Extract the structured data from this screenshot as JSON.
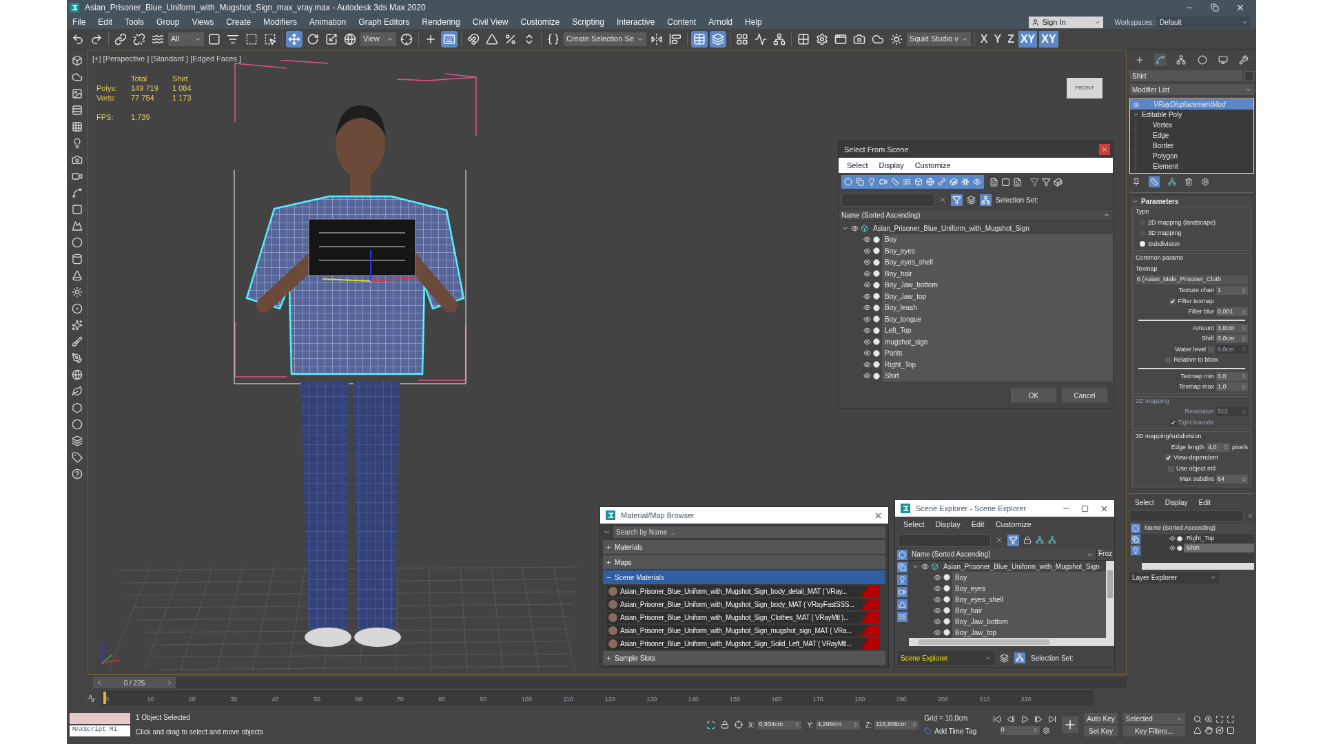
{
  "window": {
    "title": "Asian_Prisoner_Blue_Uniform_with_Mugshot_Sign_max_vray.max - Autodesk 3ds Max 2020"
  },
  "menu": [
    "File",
    "Edit",
    "Tools",
    "Group",
    "Views",
    "Create",
    "Modifiers",
    "Animation",
    "Graph Editors",
    "Rendering",
    "Civil View",
    "Customize",
    "Scripting",
    "Interactive",
    "Content",
    "Arnold",
    "Help"
  ],
  "account": {
    "sign_in": "Sign In",
    "workspaces_label": "Workspaces:",
    "workspace": "Default"
  },
  "toolbar": [
    {
      "kind": "undo",
      "selected": false
    },
    {
      "kind": "redo",
      "selected": false
    },
    {
      "kind": "sep"
    },
    {
      "kind": "link",
      "selected": false
    },
    {
      "kind": "unlink",
      "selected": false
    },
    {
      "kind": "bind",
      "selected": false
    },
    {
      "kind": "dropdown",
      "value": "All"
    },
    {
      "kind": "select",
      "selected": false
    },
    {
      "kind": "select_by_name",
      "selected": false
    },
    {
      "kind": "region",
      "selected": false
    },
    {
      "kind": "crossing",
      "selected": false
    },
    {
      "kind": "sep"
    },
    {
      "kind": "move",
      "selected": true
    },
    {
      "kind": "rotate",
      "selected": false
    },
    {
      "kind": "scale",
      "selected": false
    },
    {
      "kind": "place",
      "selected": false
    },
    {
      "kind": "dropdown",
      "value": "View"
    },
    {
      "kind": "pivot",
      "selected": false
    },
    {
      "kind": "sep"
    },
    {
      "kind": "manipulate",
      "selected": false
    },
    {
      "kind": "shortcut",
      "selected": true
    },
    {
      "kind": "sep"
    },
    {
      "kind": "snap",
      "selected": false
    },
    {
      "kind": "angle",
      "selected": false
    },
    {
      "kind": "percent",
      "selected": false
    },
    {
      "kind": "spinner",
      "selected": false
    },
    {
      "kind": "sep"
    },
    {
      "kind": "named_sel",
      "selected": false
    },
    {
      "kind": "dropdown",
      "value": "Create Selection Se"
    },
    {
      "kind": "mirror",
      "selected": false
    },
    {
      "kind": "align",
      "selected": false
    },
    {
      "kind": "sep"
    },
    {
      "kind": "scene_explorer",
      "selected": true
    },
    {
      "kind": "layer_explorer",
      "selected": true
    },
    {
      "kind": "sep"
    },
    {
      "kind": "ribbon",
      "selected": false
    },
    {
      "kind": "curve_editor",
      "selected": false
    },
    {
      "kind": "schematic",
      "selected": false
    },
    {
      "kind": "sep"
    },
    {
      "kind": "material_editor",
      "selected": false
    },
    {
      "kind": "render_setup",
      "selected": false
    },
    {
      "kind": "render_frame",
      "selected": false
    },
    {
      "kind": "render",
      "selected": false
    },
    {
      "kind": "render_cloud",
      "selected": false
    },
    {
      "kind": "active_shade",
      "selected": false
    },
    {
      "kind": "dropdown",
      "value": "Squid Studio v"
    },
    {
      "kind": "sep"
    },
    {
      "kind": "axis",
      "label": "X",
      "selected": false
    },
    {
      "kind": "axis",
      "label": "Y",
      "selected": false
    },
    {
      "kind": "axis",
      "label": "Z",
      "selected": false
    },
    {
      "kind": "axis",
      "label": "XY",
      "selected": true
    },
    {
      "kind": "axis",
      "label": "XY",
      "selected": true
    }
  ],
  "viewport": {
    "label": "[+] [Perspective ] [Standard ] [Edged Faces ]",
    "stats": {
      "headers": [
        "Total",
        "Shirt"
      ],
      "rows": [
        {
          "label": "Polys:",
          "values": [
            "149 719",
            "1 084"
          ]
        },
        {
          "label": "Verts:",
          "values": [
            "77 754",
            "1 173"
          ]
        }
      ],
      "fps_label": "FPS:",
      "fps": "1,739"
    },
    "viewcube": "FRONT"
  },
  "select_from_scene": {
    "title": "Select From Scene",
    "menu": [
      "Select",
      "Display",
      "Customize"
    ],
    "filters": [
      {
        "kind": "geometry",
        "on": true
      },
      {
        "kind": "shapes",
        "on": true
      },
      {
        "kind": "lights",
        "on": true
      },
      {
        "kind": "cameras",
        "on": true
      },
      {
        "kind": "helpers",
        "on": true
      },
      {
        "kind": "spacewarps",
        "on": true
      },
      {
        "kind": "groups",
        "on": true
      },
      {
        "kind": "xrefs",
        "on": true
      },
      {
        "kind": "bones",
        "on": true
      },
      {
        "kind": "containers",
        "on": true
      },
      {
        "kind": "particles",
        "on": true
      },
      {
        "kind": "frozen",
        "on": true
      }
    ],
    "selection_set_label": "Selection Set:",
    "column": "Name (Sorted Ascending)",
    "tree": {
      "label": "Asian_Prisoner_Blue_Uniform_with_Mugshot_Sign",
      "expanded": true,
      "children": [
        "Boy",
        "Boy_eyes",
        "Boy_eyes_shell",
        "Boy_hair",
        "Boy_Jaw_bottom",
        "Boy_Jaw_top",
        "Boy_leash",
        "Boy_tongue",
        "Left_Top",
        "mugshot_sign",
        "Pants",
        "Right_Top",
        "Shirt"
      ]
    },
    "buttons": [
      "OK",
      "Cancel"
    ]
  },
  "material_browser": {
    "title": "Material/Map Browser",
    "placeholder": "Search by Name ...",
    "groups": [
      {
        "label": "Materials",
        "expanded": false,
        "selected": false
      },
      {
        "label": "Maps",
        "expanded": false,
        "selected": false
      },
      {
        "label": "Scene Materials",
        "expanded": true,
        "selected": true,
        "items": [
          "Asian_Prisoner_Blue_Uniform_with_Mugshot_Sign_body_detail_MAT ( VRay...",
          "Asian_Prisoner_Blue_Uniform_with_Mugshot_Sign_body_MAT ( VRayFastSSS...",
          "Asian_Prisoner_Blue_Uniform_with_Mugshot_Sign_Clothes_MAT ( VRayMtl )...",
          "Asian_Prisoner_Blue_Uniform_with_Mugshot_Sign_mugshot_sign_MAT ( VRa...",
          "Asian_Prisoner_Blue_Uniform_with_Mugshot_Sign_Solid_Left_MAT ( VRayMtl..."
        ]
      },
      {
        "label": "Sample Slots",
        "expanded": false,
        "selected": false
      }
    ]
  },
  "scene_explorer": {
    "title": "Scene Explorer - Scene Explorer",
    "menu": [
      "Select",
      "Display",
      "Edit",
      "Customize"
    ],
    "column": "Name (Sorted Ascending)",
    "column_2": "Froz",
    "tree": {
      "label": "Asian_Prisoner_Blue_Uniform_with_Mugshot_Sign",
      "expanded": true,
      "children": [
        "Boy",
        "Boy_eyes",
        "Boy_eyes_shell",
        "Boy_hair",
        "Boy_Jaw_bottom",
        "Boy_Jaw_top"
      ]
    },
    "explorer": "Scene Explorer",
    "selection_set_label": "Selection Set:"
  },
  "command_panel": {
    "tabs": [
      {
        "kind": "create",
        "selected": false
      },
      {
        "kind": "modify",
        "selected": true
      },
      {
        "kind": "hierarchy",
        "selected": false
      },
      {
        "kind": "motion",
        "selected": false
      },
      {
        "kind": "display",
        "selected": false
      },
      {
        "kind": "utilities",
        "selected": false
      }
    ],
    "object_name": "Shirt",
    "modifier_list": "Modifier List",
    "stack": [
      {
        "label": "VRayDisplacementMod",
        "selected": true,
        "expanded": false
      },
      {
        "label": "Editable Poly",
        "selected": false,
        "expanded": true,
        "children": [
          "Vertex",
          "Edge",
          "Border",
          "Polygon",
          "Element"
        ]
      }
    ],
    "rollout": {
      "title": "Parameters",
      "expanded": true,
      "type_label": "Type",
      "types": [
        {
          "label": "2D mapping (landscape)",
          "selected": false
        },
        {
          "label": "3D mapping",
          "selected": false
        },
        {
          "label": "Subdivision",
          "selected": true
        }
      ],
      "groups": [
        {
          "title": "Common params",
          "disabled": false,
          "fields": [
            {
              "kind": "label",
              "label": "Texmap"
            },
            {
              "kind": "map",
              "value": "6 (Asian_Male_Prisoner_Cloth"
            },
            {
              "kind": "spinner",
              "label": "Texture chan",
              "value": "1"
            },
            {
              "kind": "checkbox",
              "label": "Filter texmap",
              "checked": true
            },
            {
              "kind": "spinner",
              "label": "Filter blur",
              "value": "0,001"
            },
            {
              "kind": "divider"
            },
            {
              "kind": "spinner",
              "label": "Amount",
              "value": "3,0cm"
            },
            {
              "kind": "spinner",
              "label": "Shift",
              "value": "0,0cm"
            },
            {
              "kind": "toggle_spinner",
              "label": "Water level",
              "value": "0,0cm",
              "checked": false
            },
            {
              "kind": "checkbox",
              "label": "Relative to bbox",
              "checked": false
            },
            {
              "kind": "divider"
            },
            {
              "kind": "spinner",
              "label": "Texmap min",
              "value": "0,0"
            },
            {
              "kind": "spinner",
              "label": "Texmap max",
              "value": "1,0"
            }
          ]
        },
        {
          "title": "2D mapping",
          "disabled": true,
          "fields": [
            {
              "kind": "spinner",
              "label": "Resolution",
              "value": "512"
            },
            {
              "kind": "checkbox",
              "label": "Tight bounds",
              "checked": true
            }
          ]
        },
        {
          "title": "3D mapping/subdivision",
          "disabled": false,
          "fields": [
            {
              "kind": "spinner",
              "label": "Edge length",
              "value": "4,0",
              "unit": "pixels"
            },
            {
              "kind": "checkbox",
              "label": "View-dependent",
              "checked": true
            },
            {
              "kind": "checkbox",
              "label": "Use object mtl",
              "checked": false
            },
            {
              "kind": "spinner",
              "label": "Max subdivs",
              "value": "64"
            }
          ]
        }
      ]
    },
    "explorer": {
      "menu": [
        "Select",
        "Display",
        "Edit"
      ],
      "column": "Name (Sorted Ascending)",
      "rows": [
        {
          "label": "Right_Top",
          "selected": false
        },
        {
          "label": "Shirt",
          "selected": true
        }
      ],
      "footer": "Layer Explorer"
    }
  },
  "timeline": {
    "position": "0 / 225",
    "level": 0,
    "ticks": [
      "0",
      "10",
      "20",
      "30",
      "40",
      "50",
      "60",
      "70",
      "80",
      "90",
      "100",
      "110",
      "120",
      "130",
      "140",
      "150",
      "160",
      "170",
      "180",
      "190",
      "200",
      "210",
      "220"
    ]
  },
  "status": {
    "script": "MAXScript Mi",
    "selection": "1 Object Selected",
    "prompt": "Click and drag to select and move objects",
    "coords": [
      {
        "label": "X:",
        "value": "0,934cm"
      },
      {
        "label": "Y:",
        "value": "4,299cm"
      },
      {
        "label": "Z:",
        "value": "118,808cm"
      }
    ],
    "grid": "Grid = 10,0cm",
    "time_tag": "Add Time Tag",
    "frame": "0",
    "auto_key": "Auto Key",
    "key_mode": "Selected",
    "set_key": "Set Key",
    "key_filters": "Key Filters..."
  }
}
